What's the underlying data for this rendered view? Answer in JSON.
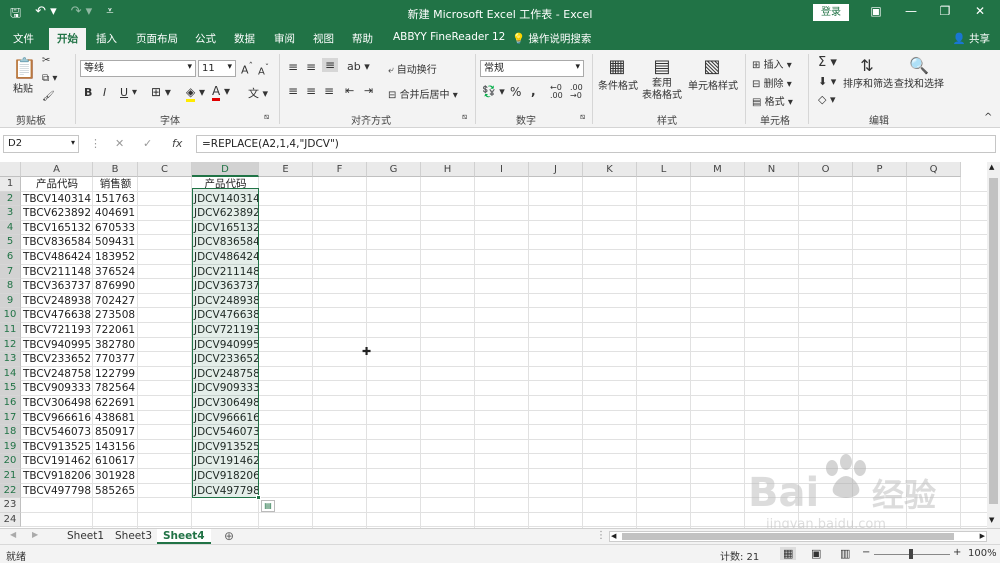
{
  "app": {
    "title": "新建 Microsoft Excel 工作表  -  Excel",
    "login": "登录"
  },
  "tabs": [
    "文件",
    "开始",
    "插入",
    "页面布局",
    "公式",
    "数据",
    "审阅",
    "视图",
    "帮助",
    "ABBYY FineReader 12",
    "操作说明搜索"
  ],
  "share": "共享",
  "ribbon": {
    "paste": "粘贴",
    "clipboard": "剪贴板",
    "font_name": "等线",
    "font_size": "11",
    "font_group": "字体",
    "bold": "B",
    "italic": "I",
    "underline": "U",
    "align_group": "对齐方式",
    "wrap": "自动换行",
    "merge": "合并后居中",
    "number_format": "常规",
    "number_group": "数字",
    "percent": "%",
    "comma": ",",
    "conditional": "条件格式",
    "table_fmt_1": "套用",
    "table_fmt_2": "表格格式",
    "cell_style": "单元格样式",
    "style_group": "样式",
    "insert": "插入",
    "delete": "删除",
    "format": "格式",
    "cells_group": "单元格",
    "sum": "Σ",
    "sort": "排序和筛选",
    "find": "查找和选择",
    "edit_group": "编辑"
  },
  "formula_bar": {
    "name_box": "D2",
    "fx": "fx",
    "formula": "=REPLACE(A2,1,4,\"JDCV\")"
  },
  "columns": [
    "A",
    "B",
    "C",
    "D",
    "E",
    "F",
    "G",
    "H",
    "I",
    "J",
    "K",
    "L",
    "M",
    "N",
    "O",
    "P",
    "Q"
  ],
  "rows": [
    "1",
    "2",
    "3",
    "4",
    "5",
    "6",
    "7",
    "8",
    "9",
    "10",
    "11",
    "12",
    "13",
    "14",
    "15",
    "16",
    "17",
    "18",
    "19",
    "20",
    "21",
    "22",
    "23",
    "24"
  ],
  "headers": {
    "a1": "产品代码",
    "b1": "销售额",
    "d1": "产品代码"
  },
  "data": [
    [
      "TBCV140314",
      "151763",
      "JDCV140314"
    ],
    [
      "TBCV623892",
      "404691",
      "JDCV623892"
    ],
    [
      "TBCV165132",
      "670533",
      "JDCV165132"
    ],
    [
      "TBCV836584",
      "509431",
      "JDCV836584"
    ],
    [
      "TBCV486424",
      "183952",
      "JDCV486424"
    ],
    [
      "TBCV211148",
      "376524",
      "JDCV211148"
    ],
    [
      "TBCV363737",
      "876990",
      "JDCV363737"
    ],
    [
      "TBCV248938",
      "702427",
      "JDCV248938"
    ],
    [
      "TBCV476638",
      "273508",
      "JDCV476638"
    ],
    [
      "TBCV721193",
      "722061",
      "JDCV721193"
    ],
    [
      "TBCV940995",
      "382780",
      "JDCV940995"
    ],
    [
      "TBCV233652",
      "770377",
      "JDCV233652"
    ],
    [
      "TBCV248758",
      "122799",
      "JDCV248758"
    ],
    [
      "TBCV909333",
      "782564",
      "JDCV909333"
    ],
    [
      "TBCV306498",
      "622691",
      "JDCV306498"
    ],
    [
      "TBCV966616",
      "438681",
      "JDCV966616"
    ],
    [
      "TBCV546073",
      "850917",
      "JDCV546073"
    ],
    [
      "TBCV913525",
      "143156",
      "JDCV913525"
    ],
    [
      "TBCV191462",
      "610617",
      "JDCV191462"
    ],
    [
      "TBCV918206",
      "301928",
      "JDCV918206"
    ],
    [
      "TBCV497798",
      "585265",
      "JDCV497798"
    ]
  ],
  "sheets": [
    "Sheet1",
    "Sheet3",
    "Sheet4"
  ],
  "active_sheet": "Sheet4",
  "status": {
    "mode": "就绪",
    "count": "计数: 21",
    "zoom": "100%"
  },
  "watermark": {
    "brand": "Bai",
    "suffix": "经验",
    "url": "jingyan.baidu.com"
  },
  "colors": {
    "excel_green": "#217346",
    "selection_fill": "#dfeee5"
  }
}
